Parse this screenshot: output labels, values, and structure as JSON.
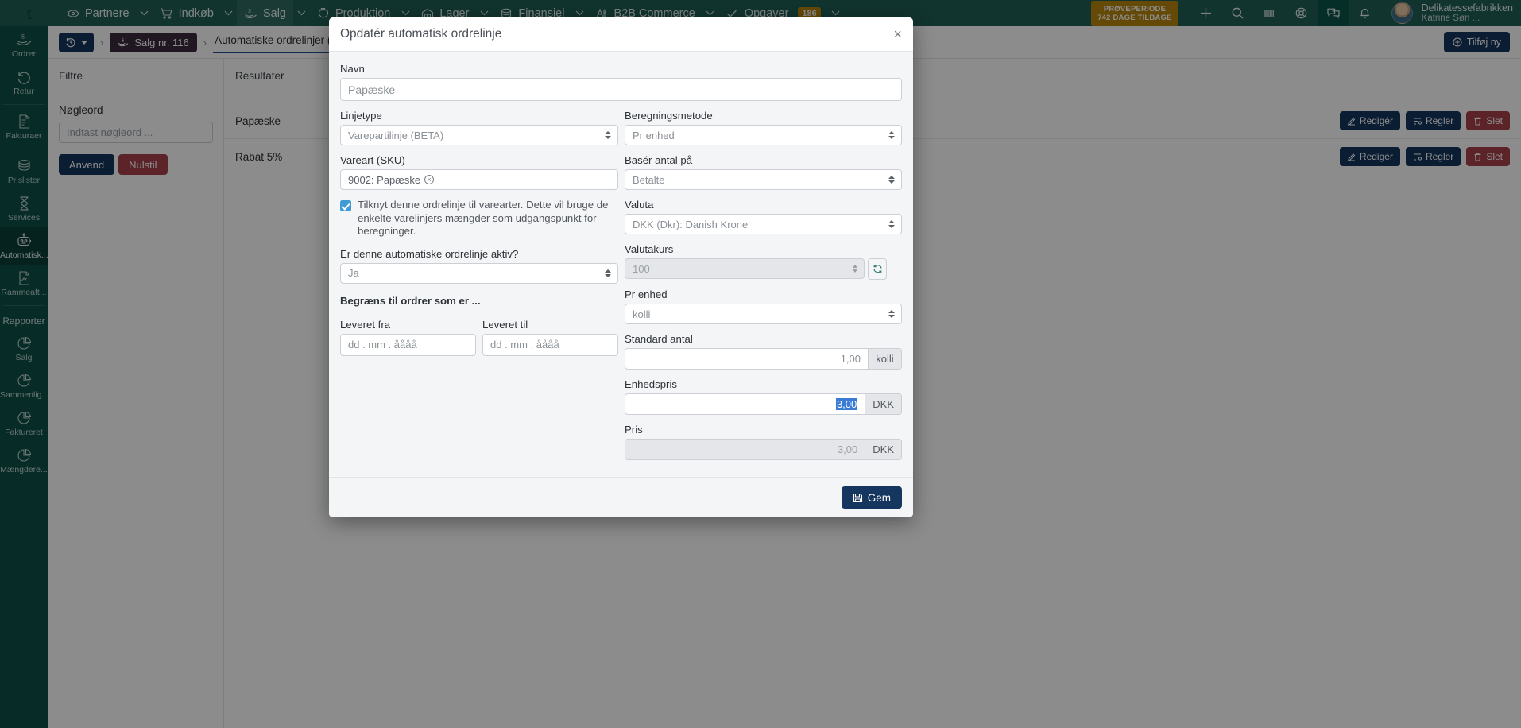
{
  "topnav": {
    "brand": "t",
    "items": [
      {
        "label": "Partnere",
        "icon": "partners-icon",
        "caret": true,
        "active": false
      },
      {
        "label": "Indkøb",
        "icon": "cart-icon",
        "caret": true,
        "active": false
      },
      {
        "label": "Salg",
        "icon": "sales-hand-icon",
        "caret": true,
        "active": true
      },
      {
        "label": "Produktion",
        "icon": "production-icon",
        "caret": true,
        "active": false
      },
      {
        "label": "Lager",
        "icon": "warehouse-icon",
        "caret": true,
        "active": false
      },
      {
        "label": "Finansiel",
        "icon": "coins-icon",
        "caret": true,
        "active": false
      },
      {
        "label": "B2B Commerce",
        "icon": "b2b-icon",
        "caret": true,
        "active": false
      },
      {
        "label": "Opgaver",
        "icon": "check-icon",
        "caret": true,
        "active": false,
        "badge": "186"
      }
    ],
    "trial": {
      "line1": "PRØVEPERIODE",
      "line2": "742 DAGE TILBAGE"
    },
    "actions": [
      "plus-icon",
      "search-icon",
      "barcode-icon",
      "lifebuoy-icon",
      "chat-icon",
      "bell-icon"
    ],
    "user": {
      "company": "Delikatessefabrikken",
      "name": "Katrine Søn ..."
    }
  },
  "rail": {
    "items": [
      {
        "label": "Ordrer",
        "icon": "sales-hand-icon",
        "selected": false
      },
      {
        "label": "Retur",
        "icon": "undo-icon",
        "selected": false
      },
      {
        "sep": true
      },
      {
        "label": "Fakturaer",
        "icon": "invoice-icon",
        "selected": false
      },
      {
        "sep": true
      },
      {
        "label": "Prislister",
        "icon": "coins-icon",
        "selected": false
      },
      {
        "label": "Services",
        "icon": "hourglass-icon",
        "selected": false
      },
      {
        "label": "Automatisk...",
        "icon": "robot-icon",
        "selected": true
      },
      {
        "label": "Rammeaft...",
        "icon": "contract-icon",
        "selected": false
      },
      {
        "sep": true
      },
      {
        "heading": "Rapporter"
      },
      {
        "label": "Salg",
        "icon": "pie-chart-icon",
        "selected": false
      },
      {
        "label": "Sammenlig...",
        "icon": "pie-chart-icon",
        "selected": false
      },
      {
        "label": "Faktureret",
        "icon": "pie-chart-icon",
        "selected": false
      },
      {
        "label": "Mængdere...",
        "icon": "pie-chart-icon",
        "selected": false
      }
    ]
  },
  "breadcrumb": {
    "history_icon": "history-icon",
    "sale_label": "Salg nr. 116",
    "current": "Automatiske ordrelinjer (BETA)",
    "sep": "›",
    "add_label": "Tilføj ny"
  },
  "filters": {
    "title": "Filtre",
    "keyword_label": "Nøgleord",
    "keyword_placeholder": "Indtast nøgleord ...",
    "apply_label": "Anvend",
    "reset_label": "Nulstil"
  },
  "results": {
    "title": "Resultater",
    "rows": [
      {
        "name": "Papæske",
        "edit": "Redigér",
        "rules": "Regler",
        "delete": "Slet"
      },
      {
        "name": "Rabat 5%",
        "edit": "Redigér",
        "rules": "Regler",
        "delete": "Slet"
      }
    ]
  },
  "modal": {
    "title": "Opdatér automatisk ordrelinje",
    "close": "×",
    "navn_label": "Navn",
    "navn_value": "Papæske",
    "linjetype_label": "Linjetype",
    "linjetype_value": "Varepartilinje (BETA)",
    "vareart_label": "Vareart (SKU)",
    "vareart_value": "9002: Papæske",
    "checkbox_text": "Tilknyt denne ordrelinje til varearter. Dette vil bruge de enkelte varelinjers mængder som udgangspunkt for beregninger.",
    "aktiv_label": "Er denne automatiske ordrelinje aktiv?",
    "aktiv_value": "Ja",
    "begraens_label": "Begræns til ordrer som er ...",
    "leveret_fra_label": "Leveret fra",
    "leveret_fra_placeholder": "dd . mm . åååå",
    "leveret_til_label": "Leveret til",
    "leveret_til_placeholder": "dd . mm . åååå",
    "beregningsmetode_label": "Beregningsmetode",
    "beregningsmetode_value": "Pr enhed",
    "basis_label": "Basér antal på",
    "basis_value": "Betalte",
    "valuta_label": "Valuta",
    "valuta_value": "DKK (Dkr): Danish Krone",
    "valutakurs_label": "Valutakurs",
    "valutakurs_value": "100",
    "prenhed_label": "Pr enhed",
    "prenhed_value": "kolli",
    "standard_antal_label": "Standard antal",
    "standard_antal_value": "1,00",
    "standard_antal_unit": "kolli",
    "enhedspris_label": "Enhedspris",
    "enhedspris_value": "3,00",
    "enhedspris_unit": "DKK",
    "pris_label": "Pris",
    "pris_value": "3,00",
    "pris_unit": "DKK",
    "save_label": "Gem"
  },
  "colors": {
    "brand_green": "#1f5f57",
    "rail_green": "#0e4f47",
    "navy": "#15365e",
    "red": "#a8434a",
    "amber": "#b8860b",
    "checkbox_blue": "#3f9ad6",
    "selection_blue": "#3a7bd5"
  }
}
